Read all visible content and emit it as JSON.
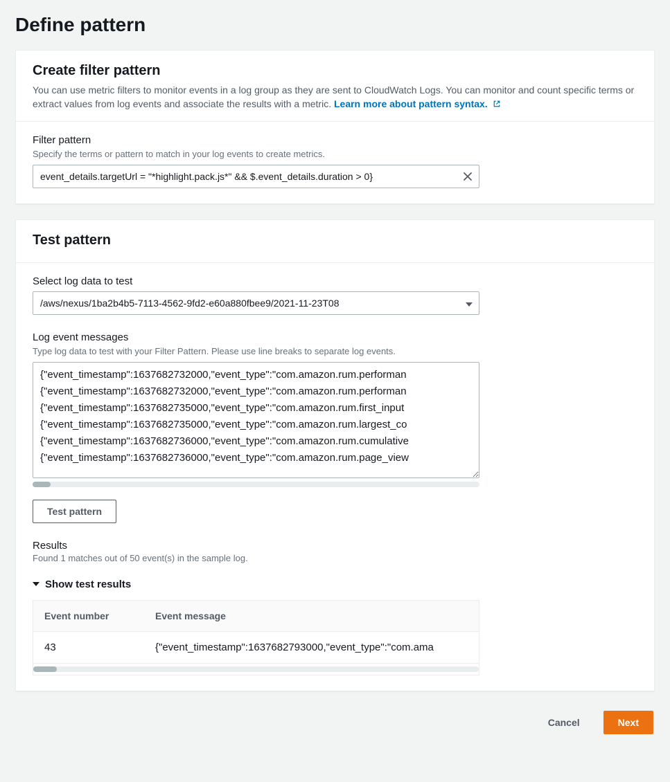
{
  "page_title": "Define pattern",
  "create_panel": {
    "title": "Create filter pattern",
    "description_prefix": "You can use metric filters to monitor events in a log group as they are sent to CloudWatch Logs. You can monitor and count specific terms or extract values from log events and associate the results with a metric. ",
    "learn_more": "Learn more about pattern syntax.",
    "filter_label": "Filter pattern",
    "filter_hint": "Specify the terms or pattern to match in your log events to create metrics.",
    "filter_value": "event_details.targetUrl = \"*highlight.pack.js*\" && $.event_details.duration > 0}"
  },
  "test_panel": {
    "title": "Test pattern",
    "select_label": "Select log data to test",
    "select_value": "/aws/nexus/1ba2b4b5-7113-4562-9fd2-e60a880fbee9/2021-11-23T08",
    "log_label": "Log event messages",
    "log_hint": "Type log data to test with your Filter Pattern. Please use line breaks to separate log events.",
    "log_lines": "{\"event_timestamp\":1637682732000,\"event_type\":\"com.amazon.rum.performan\n{\"event_timestamp\":1637682732000,\"event_type\":\"com.amazon.rum.performan\n{\"event_timestamp\":1637682735000,\"event_type\":\"com.amazon.rum.first_input\n{\"event_timestamp\":1637682735000,\"event_type\":\"com.amazon.rum.largest_co\n{\"event_timestamp\":1637682736000,\"event_type\":\"com.amazon.rum.cumulative\n{\"event_timestamp\":1637682736000,\"event_type\":\"com.amazon.rum.page_view",
    "test_button": "Test pattern",
    "results_label": "Results",
    "results_summary": "Found 1 matches out of 50 event(s) in the sample log.",
    "expander": "Show test results",
    "table": {
      "col_event_number": "Event number",
      "col_event_message": "Event message",
      "rows": [
        {
          "number": "43",
          "message": "{\"event_timestamp\":1637682793000,\"event_type\":\"com.ama"
        }
      ]
    }
  },
  "footer": {
    "cancel": "Cancel",
    "next": "Next"
  }
}
